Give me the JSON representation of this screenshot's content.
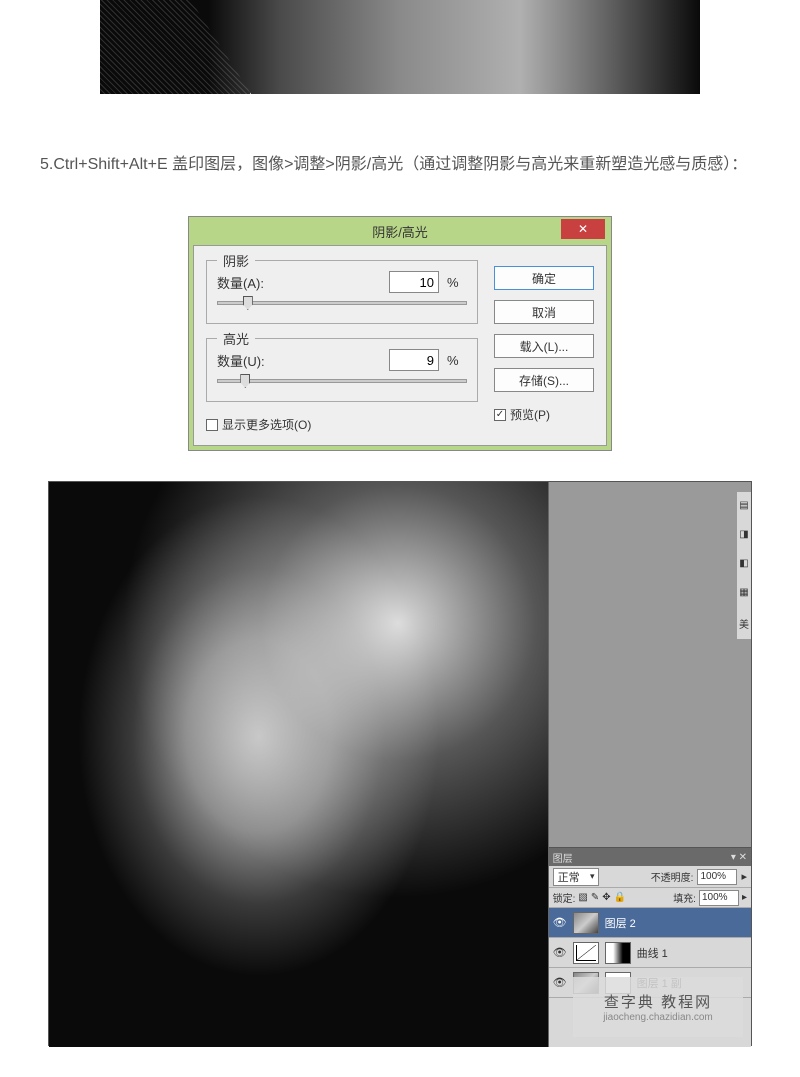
{
  "step_text": "5.Ctrl+Shift+Alt+E 盖印图层，图像>调整>阴影/高光（通过调整阴影与高光来重新塑造光感与质感）：",
  "dialog": {
    "title": "阴影/高光",
    "close": "✕",
    "shadow_legend": "阴影",
    "highlight_legend": "高光",
    "amount_a_label": "数量(A):",
    "amount_a_value": "10",
    "amount_u_label": "数量(U):",
    "amount_u_value": "9",
    "percent": "%",
    "ok": "确定",
    "cancel": "取消",
    "load": "载入(L)...",
    "save": "存储(S)...",
    "preview": "预览(P)",
    "show_more": "显示更多选项(O)"
  },
  "layers": {
    "tab": "图层",
    "blend_mode": "正常",
    "opacity_label": "不透明度:",
    "opacity_value": "100%",
    "lock_label": "锁定:",
    "fill_label": "填充:",
    "fill_value": "100%",
    "item_layer2": "图层 2",
    "item_curve1": "曲线 1",
    "item_layer1_copy": "图层 1 副"
  },
  "tool_label": "美",
  "watermark": {
    "line1": "查字典  教程网",
    "line2": "jiaocheng.chazidian.com"
  }
}
